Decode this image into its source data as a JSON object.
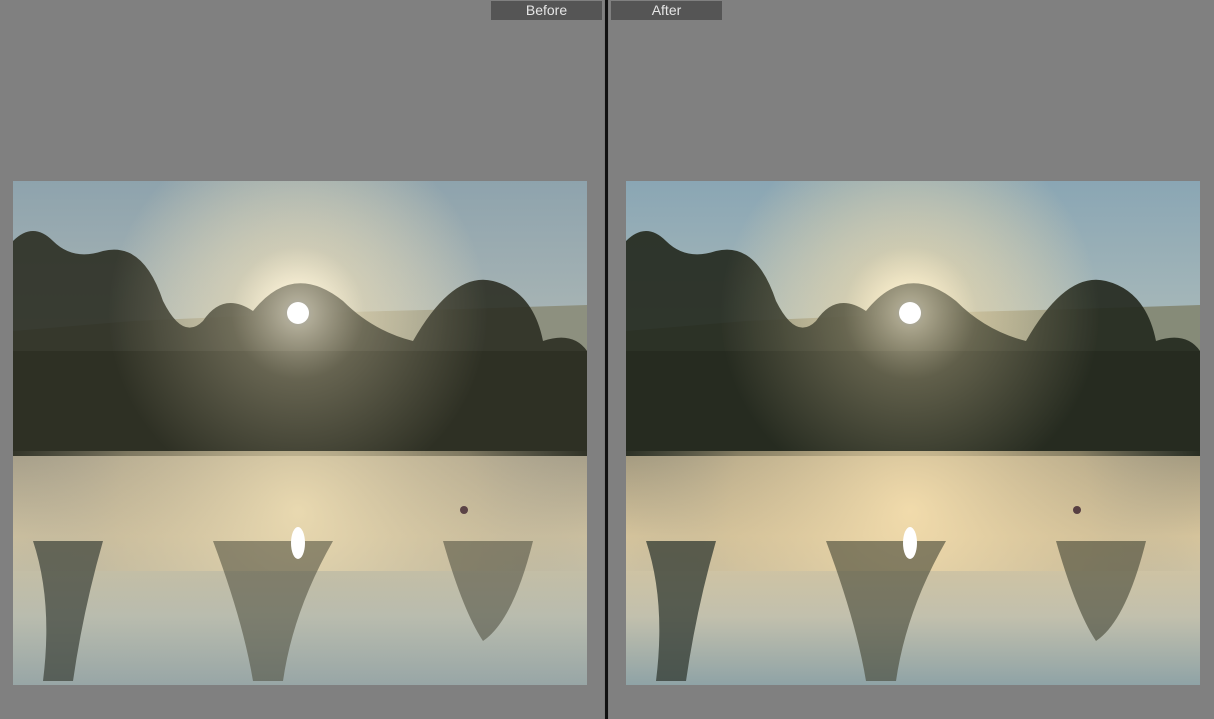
{
  "compare_view": {
    "before_label": "Before",
    "after_label": "After"
  },
  "colors": {
    "background": "#808080",
    "label_bg": "#555555",
    "label_text": "#e6e6e6",
    "divider": "#111111"
  },
  "photos": {
    "before": {
      "variant": "original"
    },
    "after": {
      "variant": "edited"
    }
  }
}
